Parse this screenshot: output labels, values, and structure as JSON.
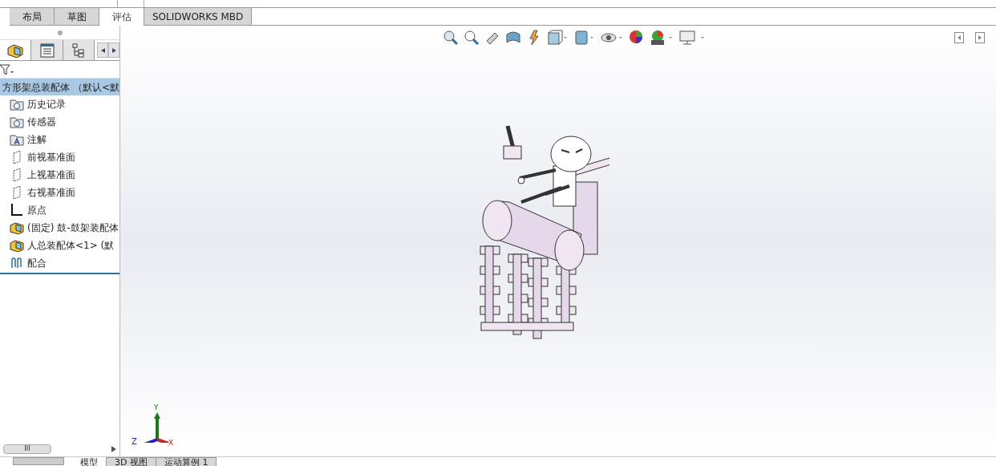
{
  "ribbon_tabs": [
    {
      "label": "布局",
      "selected": false
    },
    {
      "label": "草图",
      "selected": false
    },
    {
      "label": "评估",
      "selected": true
    },
    {
      "label": "SOLIDWORKS MBD",
      "selected": false
    }
  ],
  "panel_tabs": [
    {
      "kind": "feature",
      "selected": true
    },
    {
      "kind": "property",
      "selected": false
    },
    {
      "kind": "config",
      "selected": false
    }
  ],
  "tree": {
    "root": {
      "label": "方形架总装配体 （默认<默",
      "selected": true
    },
    "items": [
      {
        "kind": "history",
        "label": "历史记录"
      },
      {
        "kind": "sensor",
        "label": "传感器"
      },
      {
        "kind": "annotation",
        "label": "注解"
      },
      {
        "kind": "plane",
        "label": "前视基准面"
      },
      {
        "kind": "plane",
        "label": "上视基准面"
      },
      {
        "kind": "plane",
        "label": "右视基准面"
      },
      {
        "kind": "origin",
        "label": "原点"
      },
      {
        "kind": "assembly",
        "label": "(固定) 鼓-鼓架装配体"
      },
      {
        "kind": "assembly",
        "label": "人总装配体<1> (默"
      },
      {
        "kind": "mate",
        "label": "配合"
      }
    ]
  },
  "triad": {
    "x": "X",
    "y": "Y",
    "z": "Z"
  },
  "scrollbar": {
    "grip": "III"
  },
  "bottom_tabs": [
    {
      "label": "模型",
      "selected": true
    },
    {
      "label": "3D 视图",
      "selected": false
    },
    {
      "label": "运动算例 1",
      "selected": false
    }
  ]
}
